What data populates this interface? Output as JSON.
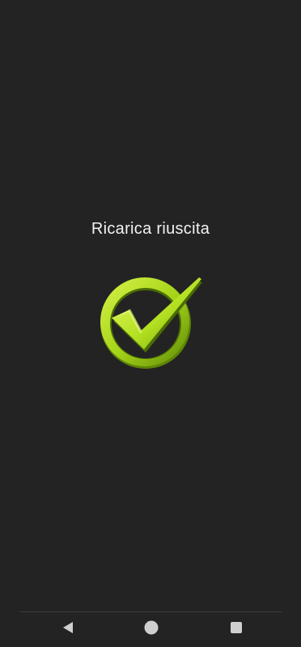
{
  "recharge": {
    "status_message": "Ricarica riuscita",
    "status_icon": "check-circle-icon"
  },
  "colors": {
    "background": "#232323",
    "text": "#f2f2f2",
    "accent": "#a7d61a",
    "nav_icon": "#cfcfcf"
  },
  "nav_bar": {
    "buttons": [
      "back-icon",
      "home-icon",
      "recents-icon"
    ]
  }
}
